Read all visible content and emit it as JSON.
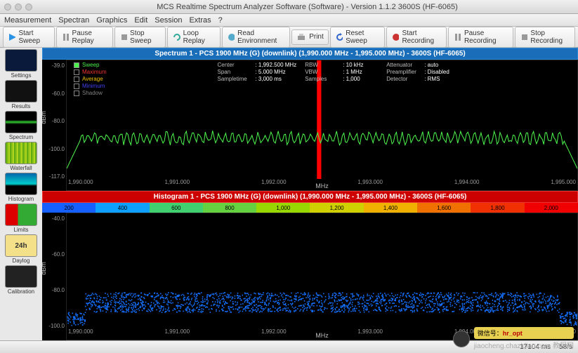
{
  "window": {
    "title": "MCS Realtime Spectrum Analyzer Software (Software) - Version 1.1.2    3600S (HF-6065)"
  },
  "menu": {
    "items": [
      "Measurement",
      "Spectran",
      "Graphics",
      "Edit",
      "Session",
      "Extras",
      "?"
    ]
  },
  "toolbar": {
    "start_sweep": "Start Sweep",
    "pause_replay": "Pause Replay",
    "stop_sweep": "Stop Sweep",
    "loop_replay": "Loop Replay",
    "read_environment": "Read Environment",
    "print": "Print",
    "reset_sweep": "Reset Sweep",
    "start_recording": "Start Recording",
    "pause_recording": "Pause Recording",
    "stop_recording": "Stop Recording"
  },
  "sidebar": {
    "items": [
      "Settings",
      "Results",
      "Spectrum",
      "Waterfall",
      "Histogram",
      "Limits",
      "Daylog",
      "Calibration"
    ]
  },
  "spectrum": {
    "title": "Spectrum 1 - PCS 1900 MHz (G) (downlink) (1,990.000 MHz - 1,995.000 MHz) - 3600S (HF-6065)",
    "legend": {
      "sweep": "Sweep",
      "maximum": "Maximum",
      "average": "Average",
      "minimum": "Minimum",
      "shadow": "Shadow"
    },
    "legend_colors": {
      "sweep": "#4cf04c",
      "maximum": "#f03333",
      "average": "#f0c000",
      "minimum": "#4040f0",
      "shadow": "#808080"
    },
    "params": {
      "center_k": "Center",
      "center_v": ": 1,992.500 MHz",
      "span_k": "Span",
      "span_v": ": 5.000 MHz",
      "sampletime_k": "Sampletime",
      "sampletime_v": ": 3,000 ms",
      "rbw_k": "RBW",
      "rbw_v": ": 10 kHz",
      "vbw_k": "VBW",
      "vbw_v": ": 1 MHz",
      "samples_k": "Samples",
      "samples_v": ": 1,000",
      "attenuator_k": "Attenuator",
      "attenuator_v": ": auto",
      "preamp_k": "Preamplifier",
      "preamp_v": ": Disabled",
      "detector_k": "Detector",
      "detector_v": ": RMS"
    },
    "yticks": [
      "-39.0",
      "-60.0",
      "-80.0",
      "-100.0",
      "-117.0"
    ],
    "ylabel": "dBm",
    "xticks": [
      "1,990.000",
      "1,991.000",
      "1,992.000",
      "1,993.000",
      "1,994.000",
      "1,995.000"
    ],
    "xlabel": "MHz"
  },
  "histogram": {
    "title": "Histogram 1 - PCS 1900 MHz (G) (downlink) (1,990.000 MHz - 1,995.000 MHz) - 3600S (HF-6065)",
    "colorbar": [
      "200",
      "400",
      "600",
      "800",
      "1,000",
      "1,200",
      "1,400",
      "1,600",
      "1,800",
      "2,000"
    ],
    "colorbar_colors": [
      "#1560ff",
      "#0ea0ff",
      "#40d070",
      "#65d040",
      "#98d800",
      "#d0d000",
      "#f0b000",
      "#f07000",
      "#f03000",
      "#f00000"
    ],
    "yticks": [
      "-40.0",
      "-60.0",
      "-80.0",
      "-100.0"
    ],
    "ylabel": "dBm",
    "xticks": [
      "1,990.000",
      "1,991.000",
      "1,992.000",
      "1,993.000",
      "1,994.000",
      "1,995.000"
    ],
    "xlabel": "MHz"
  },
  "status": {
    "time": "17104 ms",
    "rate": "58/s"
  },
  "watermark": {
    "badge_prefix": "微信号：",
    "badge_id": "hr_opt",
    "site": "jiaocheng.chazidian.com",
    "site_cn": "教程网"
  },
  "chart_data": [
    {
      "type": "line",
      "name": "Spectrum Sweep",
      "xlabel": "MHz",
      "ylabel": "dBm",
      "xlim": [
        1990.0,
        1995.0
      ],
      "ylim": [
        -117.0,
        -39.0
      ],
      "series": [
        {
          "name": "Sweep",
          "color": "#4cf04c",
          "description": "noisy trace oscillating approx between -86 and -95 dBm across full span with edge roll-off near -110 at both ends"
        }
      ],
      "marker": {
        "x": 1992.45,
        "color": "#f00000",
        "description": "vertical red cursor bar"
      }
    },
    {
      "type": "heatmap",
      "name": "Histogram",
      "xlabel": "MHz",
      "ylabel": "dBm",
      "xlim": [
        1990.0,
        1995.0
      ],
      "ylim": [
        -110.0,
        -40.0
      ],
      "density_band": {
        "y_low": -100.0,
        "y_high": -86.0,
        "description": "scattered blue density band across full span with edge roll-off"
      }
    }
  ]
}
